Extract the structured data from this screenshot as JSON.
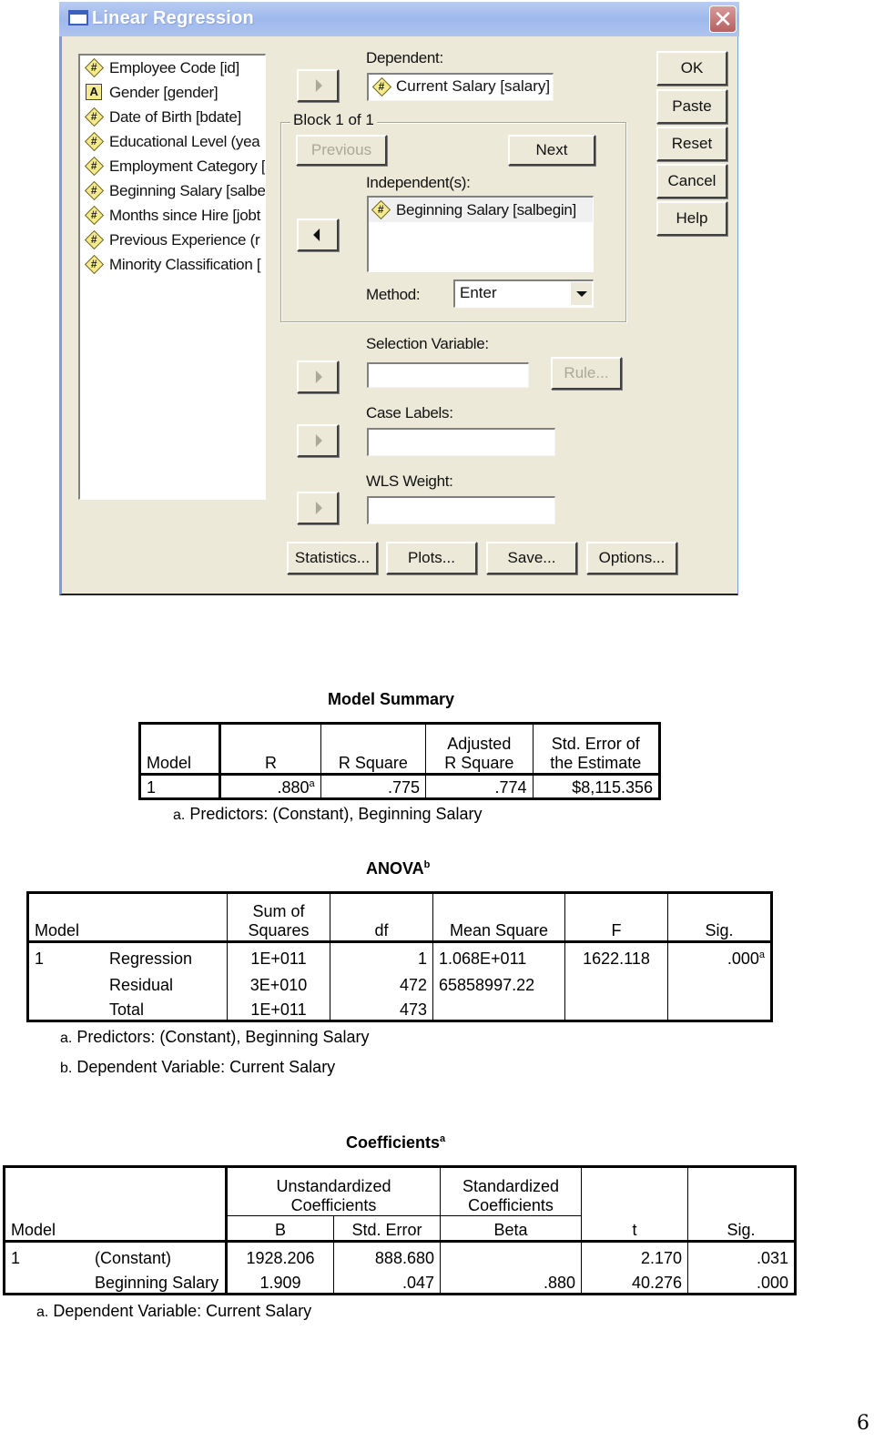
{
  "dialog": {
    "title": "Linear Regression",
    "close_glyph": "✕",
    "variables": [
      {
        "icon": "numeric",
        "label": "Employee Code [id]"
      },
      {
        "icon": "string",
        "label": "Gender [gender]"
      },
      {
        "icon": "numeric",
        "label": "Date of Birth [bdate]"
      },
      {
        "icon": "numeric",
        "label": "Educational Level (yea"
      },
      {
        "icon": "numeric",
        "label": "Employment Category ["
      },
      {
        "icon": "numeric",
        "label": "Beginning Salary [salbe"
      },
      {
        "icon": "numeric",
        "label": "Months since Hire [jobt"
      },
      {
        "icon": "numeric",
        "label": "Previous Experience (r"
      },
      {
        "icon": "numeric",
        "label": "Minority Classification ["
      }
    ],
    "dependent_label": "Dependent:",
    "dependent_value": "Current Salary [salary]",
    "block_label": "Block 1 of 1",
    "previous_label": "Previous",
    "next_label": "Next",
    "independents_label": "Independent(s):",
    "independents": [
      "Beginning Salary [salbegin]"
    ],
    "method_label": "Method:",
    "method_value": "Enter",
    "selection_label": "Selection Variable:",
    "rule_label": "Rule...",
    "case_labels_label": "Case Labels:",
    "wls_label": "WLS Weight:",
    "side_buttons": {
      "ok": "OK",
      "paste": "Paste",
      "reset": "Reset",
      "cancel": "Cancel",
      "help": "Help"
    },
    "bottom_buttons": {
      "statistics": "Statistics...",
      "plots": "Plots...",
      "save": "Save...",
      "options": "Options..."
    }
  },
  "model_summary": {
    "title": "Model Summary",
    "headers": {
      "model": "Model",
      "r": "R",
      "r_square": "R Square",
      "adj_1": "Adjusted",
      "adj_2": "R Square",
      "se_1": "Std. Error of",
      "se_2": "the Estimate"
    },
    "row": {
      "model": "1",
      "r": ".880",
      "r_sup": "a",
      "r_square": ".775",
      "adj_r_square": ".774",
      "se": "$8,115.356"
    },
    "footnote_mark": "a.",
    "footnote": "Predictors: (Constant), Beginning Salary"
  },
  "anova": {
    "title": "ANOVA",
    "title_sup": "b",
    "headers": {
      "model": "Model",
      "ss_1": "Sum of",
      "ss_2": "Squares",
      "df": "df",
      "ms": "Mean Square",
      "f": "F",
      "sig": "Sig."
    },
    "model": "1",
    "rows": [
      {
        "name": "Regression",
        "ss": "1E+011",
        "df": "1",
        "ms": "1.068E+011",
        "f": "1622.118",
        "sig": ".000",
        "sig_sup": "a"
      },
      {
        "name": "Residual",
        "ss": "3E+010",
        "df": "472",
        "ms": "65858997.22",
        "f": "",
        "sig": "",
        "sig_sup": ""
      },
      {
        "name": "Total",
        "ss": "1E+011",
        "df": "473",
        "ms": "",
        "f": "",
        "sig": "",
        "sig_sup": ""
      }
    ],
    "footnotes": [
      {
        "mark": "a.",
        "text": "Predictors: (Constant), Beginning Salary"
      },
      {
        "mark": "b.",
        "text": "Dependent Variable: Current Salary"
      }
    ]
  },
  "coefficients": {
    "title": "Coefficients",
    "title_sup": "a",
    "headers": {
      "model": "Model",
      "unstd_1": "Unstandardized",
      "unstd_2": "Coefficients",
      "std_1": "Standardized",
      "std_2": "Coefficients",
      "b": "B",
      "se": "Std. Error",
      "beta": "Beta",
      "t": "t",
      "sig": "Sig."
    },
    "model": "1",
    "rows": [
      {
        "name": "(Constant)",
        "b": "1928.206",
        "se": "888.680",
        "beta": "",
        "t": "2.170",
        "sig": ".031"
      },
      {
        "name": "Beginning Salary",
        "b": "1.909",
        "se": ".047",
        "beta": ".880",
        "t": "40.276",
        "sig": ".000"
      }
    ],
    "footnote_mark": "a.",
    "footnote": "Dependent Variable: Current Salary"
  },
  "page_number": "6"
}
